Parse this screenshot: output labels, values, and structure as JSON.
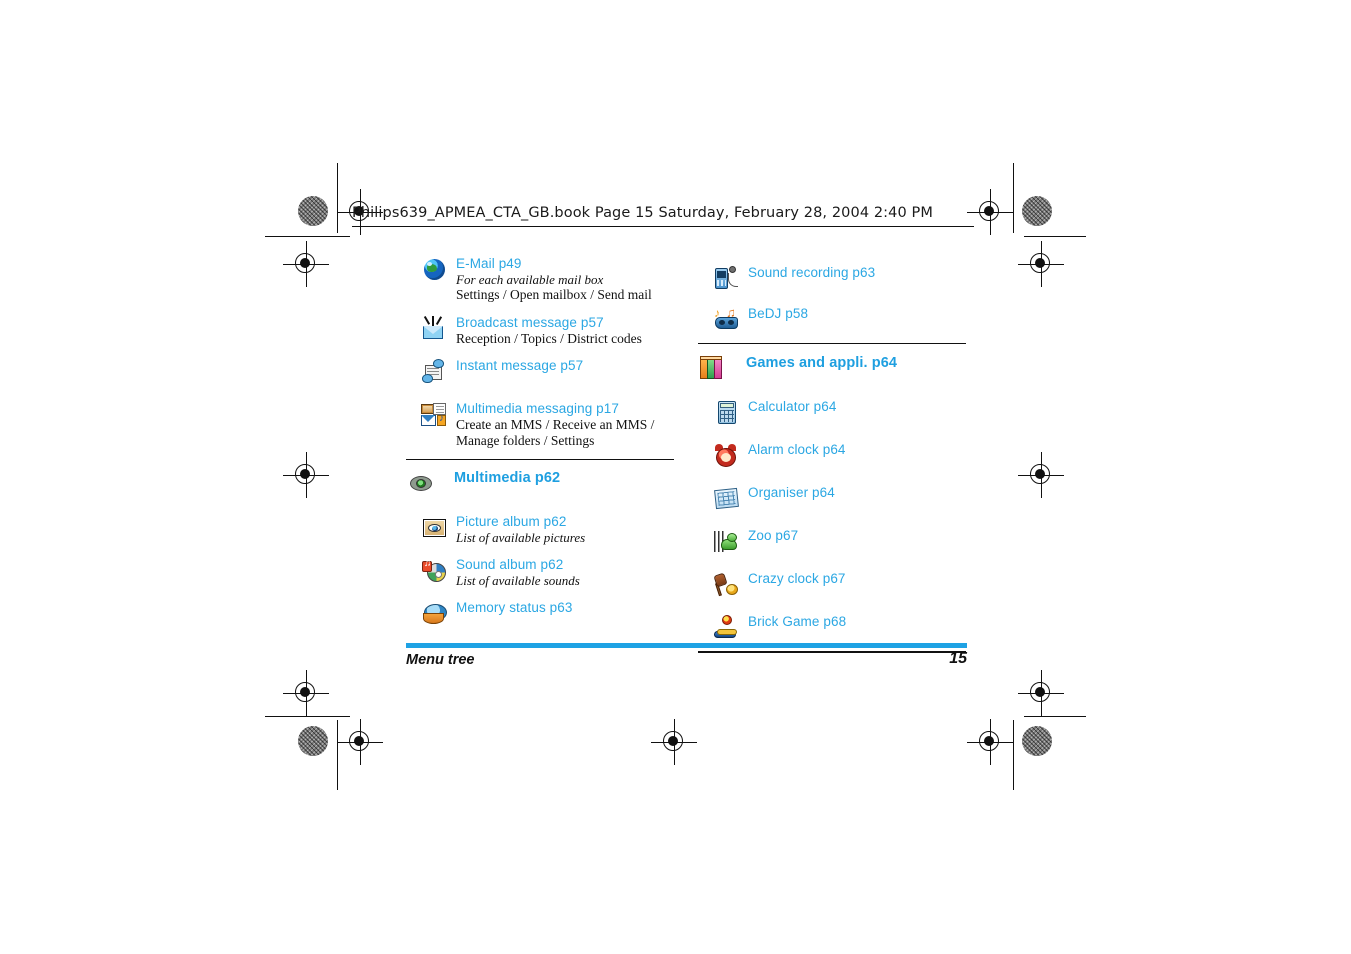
{
  "document": {
    "header_line": "Philips639_APMEA_CTA_GB.book  Page 15  Saturday, February 28, 2004  2:40 PM",
    "footer_label": "Menu tree",
    "page_number": "15"
  },
  "colors": {
    "heading_blue": "#1E9FE0",
    "item_blue": "#2BA7E3",
    "footer_bar": "#1EA2E4",
    "rule": "#111111",
    "body_text": "#111111"
  },
  "columns": {
    "left": [
      {
        "icon": "globe-icon",
        "level": 2,
        "title": "E-Mail p49",
        "sub_italic": "For each available mail box",
        "sub_plain": "Settings / Open mailbox / Send mail"
      },
      {
        "icon": "broadcast-envelope-icon",
        "level": 2,
        "title": "Broadcast message p57",
        "sub_plain": "Reception / Topics / District codes"
      },
      {
        "icon": "instant-message-icon",
        "level": 2,
        "title": "Instant message p57"
      },
      {
        "icon": "multimedia-messaging-icon",
        "level": 2,
        "title": "Multimedia messaging p17",
        "sub_plain": "Create an MMS / Receive an MMS / Manage folders / Settings"
      },
      {
        "divider": true
      },
      {
        "icon": "multimedia-joystick-icon",
        "level": 1,
        "title": "Multimedia p62"
      },
      {
        "icon": "picture-album-icon",
        "level": 2,
        "title": "Picture album p62",
        "sub_italic": "List of available pictures"
      },
      {
        "icon": "sound-album-icon",
        "level": 2,
        "title": "Sound album p62",
        "sub_italic": "List of available sounds"
      },
      {
        "icon": "memory-status-icon",
        "level": 2,
        "title": "Memory status p63"
      }
    ],
    "right": [
      {
        "icon": "sound-recording-icon",
        "level": 2,
        "title": "Sound recording p63"
      },
      {
        "icon": "bedj-icon",
        "level": 2,
        "title": "BeDJ p58"
      },
      {
        "divider": true
      },
      {
        "icon": "games-books-icon",
        "level": 1,
        "title": "Games and appli. p64"
      },
      {
        "icon": "calculator-icon",
        "level": 2,
        "title": "Calculator p64"
      },
      {
        "icon": "alarm-clock-icon",
        "level": 2,
        "title": "Alarm clock p64"
      },
      {
        "icon": "organiser-icon",
        "level": 2,
        "title": "Organiser p64"
      },
      {
        "icon": "zoo-icon",
        "level": 2,
        "title": "Zoo p67"
      },
      {
        "icon": "crazy-clock-icon",
        "level": 2,
        "title": "Crazy clock p67"
      },
      {
        "icon": "brick-game-icon",
        "level": 2,
        "title": "Brick Game p68"
      },
      {
        "divider": true
      }
    ]
  },
  "print_marks": {
    "registration_marks": 8,
    "halftone_patches": 4,
    "description": "offset printing registration targets and trim marks"
  }
}
